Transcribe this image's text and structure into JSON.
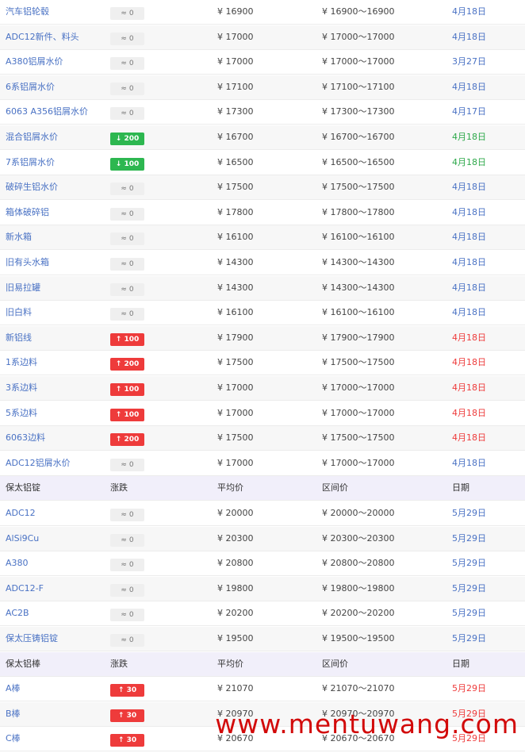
{
  "rows": [
    {
      "type": "item",
      "name": "汽车铝轮毂",
      "change": "0",
      "dir": "flat",
      "avg": "¥ 16900",
      "range": "¥ 16900～16900",
      "date": "4月18日"
    },
    {
      "type": "item",
      "name": "ADC12新件、料头",
      "change": "0",
      "dir": "flat",
      "avg": "¥ 17000",
      "range": "¥ 17000～17000",
      "date": "4月18日"
    },
    {
      "type": "item",
      "name": "A380铝屑水价",
      "change": "0",
      "dir": "flat",
      "avg": "¥ 17000",
      "range": "¥ 17000～17000",
      "date": "3月27日"
    },
    {
      "type": "item",
      "name": "6系铝屑水价",
      "change": "0",
      "dir": "flat",
      "avg": "¥ 17100",
      "range": "¥ 17100～17100",
      "date": "4月18日"
    },
    {
      "type": "item",
      "name": "6063 A356铝屑水价",
      "change": "0",
      "dir": "flat",
      "avg": "¥ 17300",
      "range": "¥ 17300～17300",
      "date": "4月17日"
    },
    {
      "type": "item",
      "name": "混合铝屑水价",
      "change": "200",
      "dir": "down",
      "avg": "¥ 16700",
      "range": "¥ 16700～16700",
      "date": "4月18日"
    },
    {
      "type": "item",
      "name": "7系铝屑水价",
      "change": "100",
      "dir": "down",
      "avg": "¥ 16500",
      "range": "¥ 16500～16500",
      "date": "4月18日"
    },
    {
      "type": "item",
      "name": "破碎生铝水价",
      "change": "0",
      "dir": "flat",
      "avg": "¥ 17500",
      "range": "¥ 17500～17500",
      "date": "4月18日"
    },
    {
      "type": "item",
      "name": "箱体破碎铝",
      "change": "0",
      "dir": "flat",
      "avg": "¥ 17800",
      "range": "¥ 17800～17800",
      "date": "4月18日"
    },
    {
      "type": "item",
      "name": "新水箱",
      "change": "0",
      "dir": "flat",
      "avg": "¥ 16100",
      "range": "¥ 16100～16100",
      "date": "4月18日"
    },
    {
      "type": "item",
      "name": "旧有头水箱",
      "change": "0",
      "dir": "flat",
      "avg": "¥ 14300",
      "range": "¥ 14300～14300",
      "date": "4月18日"
    },
    {
      "type": "item",
      "name": "旧易拉罐",
      "change": "0",
      "dir": "flat",
      "avg": "¥ 14300",
      "range": "¥ 14300～14300",
      "date": "4月18日"
    },
    {
      "type": "item",
      "name": "旧白料",
      "change": "0",
      "dir": "flat",
      "avg": "¥ 16100",
      "range": "¥ 16100～16100",
      "date": "4月18日"
    },
    {
      "type": "item",
      "name": "新铝线",
      "change": "100",
      "dir": "up",
      "avg": "¥ 17900",
      "range": "¥ 17900～17900",
      "date": "4月18日"
    },
    {
      "type": "item",
      "name": "1系边料",
      "change": "200",
      "dir": "up",
      "avg": "¥ 17500",
      "range": "¥ 17500～17500",
      "date": "4月18日"
    },
    {
      "type": "item",
      "name": "3系边料",
      "change": "100",
      "dir": "up",
      "avg": "¥ 17000",
      "range": "¥ 17000～17000",
      "date": "4月18日"
    },
    {
      "type": "item",
      "name": "5系边料",
      "change": "100",
      "dir": "up",
      "avg": "¥ 17000",
      "range": "¥ 17000～17000",
      "date": "4月18日"
    },
    {
      "type": "item",
      "name": "6063边料",
      "change": "200",
      "dir": "up",
      "avg": "¥ 17500",
      "range": "¥ 17500～17500",
      "date": "4月18日"
    },
    {
      "type": "item",
      "name": "ADC12铝屑水价",
      "change": "0",
      "dir": "flat",
      "avg": "¥ 17000",
      "range": "¥ 17000～17000",
      "date": "4月18日"
    },
    {
      "type": "head",
      "name": "保太铝锭",
      "change": "涨跌",
      "avg": "平均价",
      "range": "区间价",
      "date": "日期"
    },
    {
      "type": "item",
      "name": "ADC12",
      "change": "0",
      "dir": "flat",
      "avg": "¥ 20000",
      "range": "¥ 20000～20000",
      "date": "5月29日"
    },
    {
      "type": "item",
      "name": "AlSi9Cu",
      "change": "0",
      "dir": "flat",
      "avg": "¥ 20300",
      "range": "¥ 20300～20300",
      "date": "5月29日"
    },
    {
      "type": "item",
      "name": "A380",
      "change": "0",
      "dir": "flat",
      "avg": "¥ 20800",
      "range": "¥ 20800～20800",
      "date": "5月29日"
    },
    {
      "type": "item",
      "name": "ADC12-F",
      "change": "0",
      "dir": "flat",
      "avg": "¥ 19800",
      "range": "¥ 19800～19800",
      "date": "5月29日"
    },
    {
      "type": "item",
      "name": "AC2B",
      "change": "0",
      "dir": "flat",
      "avg": "¥ 20200",
      "range": "¥ 20200～20200",
      "date": "5月29日"
    },
    {
      "type": "item",
      "name": "保太压铸铝锭",
      "change": "0",
      "dir": "flat",
      "avg": "¥ 19500",
      "range": "¥ 19500～19500",
      "date": "5月29日"
    },
    {
      "type": "head",
      "name": "保太铝棒",
      "change": "涨跌",
      "avg": "平均价",
      "range": "区间价",
      "date": "日期"
    },
    {
      "type": "item",
      "name": "A棒",
      "change": "30",
      "dir": "up",
      "avg": "¥ 21070",
      "range": "¥ 21070～21070",
      "date": "5月29日"
    },
    {
      "type": "item",
      "name": "B棒",
      "change": "30",
      "dir": "up",
      "avg": "¥ 20970",
      "range": "¥ 20970～20970",
      "date": "5月29日"
    },
    {
      "type": "item",
      "name": "C棒",
      "change": "30",
      "dir": "up",
      "avg": "¥ 20670",
      "range": "¥ 20670～20670",
      "date": "5月29日"
    }
  ],
  "symbols": {
    "flat": "≈",
    "up": "↑",
    "down": "↓"
  },
  "colors": {
    "up": "#ee3b3b",
    "down": "#2db750",
    "link": "#4a72c4",
    "header_bg": "#f1effa"
  },
  "watermark": "www.mentuwang.com"
}
